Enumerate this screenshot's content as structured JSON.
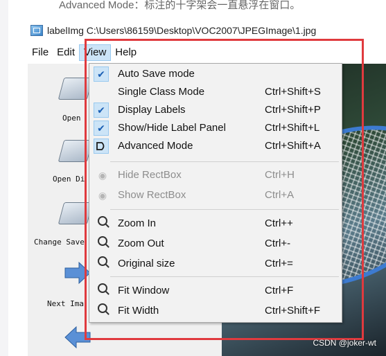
{
  "caption_top": "Advanced Mode：标注的十字架会一直悬浮在窗口。",
  "window": {
    "title": "labelImg C:\\Users\\86159\\Desktop\\VOC2007\\JPEGImage\\1.jpg"
  },
  "menubar": {
    "file": "File",
    "edit": "Edit",
    "view": "View",
    "help": "Help"
  },
  "toolbar": {
    "open": "Open",
    "open_dir": "Open Di",
    "change_save": "Change Save",
    "next_image": "Next Ima"
  },
  "view_menu": {
    "items": [
      {
        "label": "Auto Save mode",
        "shortcut": "",
        "checked": true,
        "icon": "check-icon"
      },
      {
        "label": "Single Class Mode",
        "shortcut": "Ctrl+Shift+S",
        "checked": false,
        "icon": ""
      },
      {
        "label": "Display Labels",
        "shortcut": "Ctrl+Shift+P",
        "checked": true,
        "icon": "check-icon"
      },
      {
        "label": "Show/Hide Label Panel",
        "shortcut": "Ctrl+Shift+L",
        "checked": true,
        "icon": "check-icon"
      },
      {
        "label": "Advanced Mode",
        "shortcut": "Ctrl+Shift+A",
        "checked": true,
        "icon": "advanced-mode-icon"
      },
      {
        "label": "Hide RectBox",
        "shortcut": "Ctrl+H",
        "disabled": true,
        "icon": "eye-icon"
      },
      {
        "label": "Show RectBox",
        "shortcut": "Ctrl+A",
        "disabled": true,
        "icon": "eye-icon"
      },
      {
        "label": "Zoom In",
        "shortcut": "Ctrl++",
        "icon": "zoom-in-icon"
      },
      {
        "label": "Zoom Out",
        "shortcut": "Ctrl+-",
        "icon": "zoom-out-icon"
      },
      {
        "label": "Original size",
        "shortcut": "Ctrl+=",
        "icon": "original-size-icon"
      },
      {
        "label": "Fit Window",
        "shortcut": "Ctrl+F",
        "icon": "fit-window-icon"
      },
      {
        "label": "Fit Width",
        "shortcut": "Ctrl+Shift+F",
        "icon": "fit-width-icon"
      }
    ]
  },
  "watermark": "CSDN @joker-wt",
  "colors": {
    "highlight": "#cce4f7",
    "annotation_box": "#e03a3e"
  }
}
